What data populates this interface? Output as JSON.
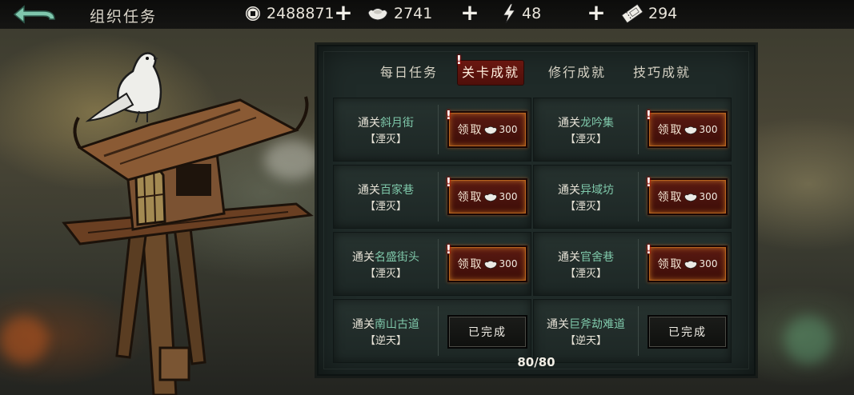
{
  "header": {
    "title": "组织任务",
    "back_icon": "back-arrow-icon"
  },
  "resources": [
    {
      "name": "copper-coin",
      "icon": "coin-icon",
      "value": "2488871"
    },
    {
      "name": "silver",
      "icon": "silver-ingot-icon",
      "value": "2741"
    },
    {
      "name": "energy",
      "icon": "lightning-icon",
      "value": "48"
    },
    {
      "name": "ticket",
      "icon": "ticket-icon",
      "value": "294"
    }
  ],
  "plus_label": "+",
  "tabs": [
    {
      "label": "每日任务",
      "active": false
    },
    {
      "label": "关卡成就",
      "active": true
    },
    {
      "label": "修行成就",
      "active": false
    },
    {
      "label": "技巧成就",
      "active": false
    }
  ],
  "alert_mark": "!",
  "tasks": [
    {
      "prefix": "通关",
      "place": "斜月街",
      "mode": "【湮灭】",
      "status": "claim",
      "button_label": "领取",
      "reward": "300"
    },
    {
      "prefix": "通关",
      "place": "龙吟集",
      "mode": "【湮灭】",
      "status": "claim",
      "button_label": "领取",
      "reward": "300"
    },
    {
      "prefix": "通关",
      "place": "百家巷",
      "mode": "【湮灭】",
      "status": "claim",
      "button_label": "领取",
      "reward": "300"
    },
    {
      "prefix": "通关",
      "place": "异域坊",
      "mode": "【湮灭】",
      "status": "claim",
      "button_label": "领取",
      "reward": "300"
    },
    {
      "prefix": "通关",
      "place": "名盛街头",
      "mode": "【湮灭】",
      "status": "claim",
      "button_label": "领取",
      "reward": "300"
    },
    {
      "prefix": "通关",
      "place": "官舍巷",
      "mode": "【湮灭】",
      "status": "claim",
      "button_label": "领取",
      "reward": "300"
    },
    {
      "prefix": "通关",
      "place": "南山古道",
      "mode": "【逆天】",
      "status": "done",
      "button_label": "已完成",
      "reward": ""
    },
    {
      "prefix": "通关",
      "place": "巨斧劫难道",
      "mode": "【逆天】",
      "status": "done",
      "button_label": "已完成",
      "reward": ""
    }
  ],
  "progress": "80/80",
  "colors": {
    "accent_red": "#5a1a12",
    "place_green": "#7fc8aa",
    "panel_bg": "#1f2a28"
  }
}
